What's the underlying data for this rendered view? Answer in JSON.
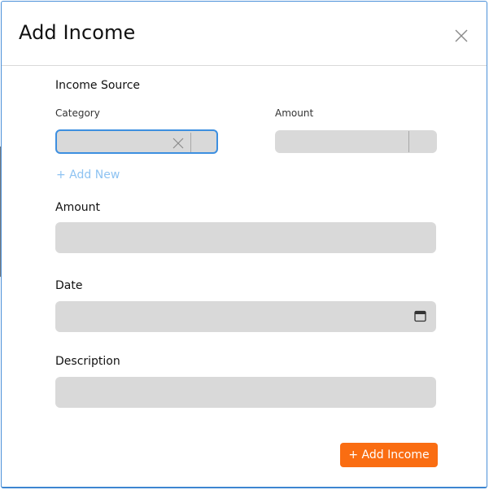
{
  "modal": {
    "title": "Add Income"
  },
  "income_source": {
    "heading": "Income Source",
    "category_label": "Category",
    "amount_label": "Amount",
    "category_value": "",
    "amount_value": "",
    "add_new_label": "+ Add New"
  },
  "fields": {
    "amount_label": "Amount",
    "amount_value": "",
    "date_label": "Date",
    "date_value": "",
    "description_label": "Description",
    "description_value": ""
  },
  "actions": {
    "submit_label": "+ Add Income"
  },
  "icons": {
    "close": "close-icon",
    "clear": "clear-icon",
    "calendar": "calendar-icon"
  },
  "colors": {
    "accent_blue": "#3d8fe0",
    "link_blue": "#8ec3f2",
    "submit_orange": "#fa6d12",
    "field_gray": "#d9d9d9"
  }
}
